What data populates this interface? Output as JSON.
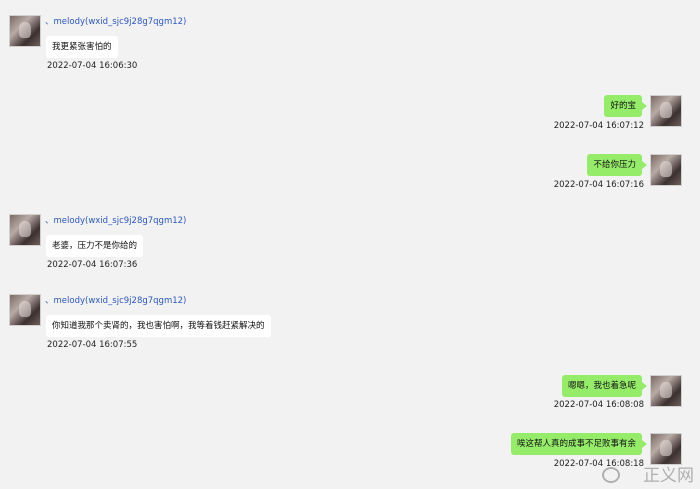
{
  "contact_name": "、melody(wxid_sjc9j28g7qgm12)",
  "messages": [
    {
      "text": "我更紧张害怕的",
      "time": "2022-07-04 16:06:30"
    },
    {
      "text": "好的宝",
      "time": "2022-07-04 16:07:12"
    },
    {
      "text": "不给你压力",
      "time": "2022-07-04 16:07:16"
    },
    {
      "text": "老婆，压力不是你给的",
      "time": "2022-07-04 16:07:36"
    },
    {
      "text": "你知道我那个卖肾的，我也害怕啊，我等着钱赶紧解决的",
      "time": "2022-07-04 16:07:55"
    },
    {
      "text": "嗯嗯，我也着急呢",
      "time": "2022-07-04 16:08:08"
    },
    {
      "text": "唉这帮人真的成事不足败事有余",
      "time": "2022-07-04 16:08:18"
    }
  ],
  "watermark": "正义网"
}
